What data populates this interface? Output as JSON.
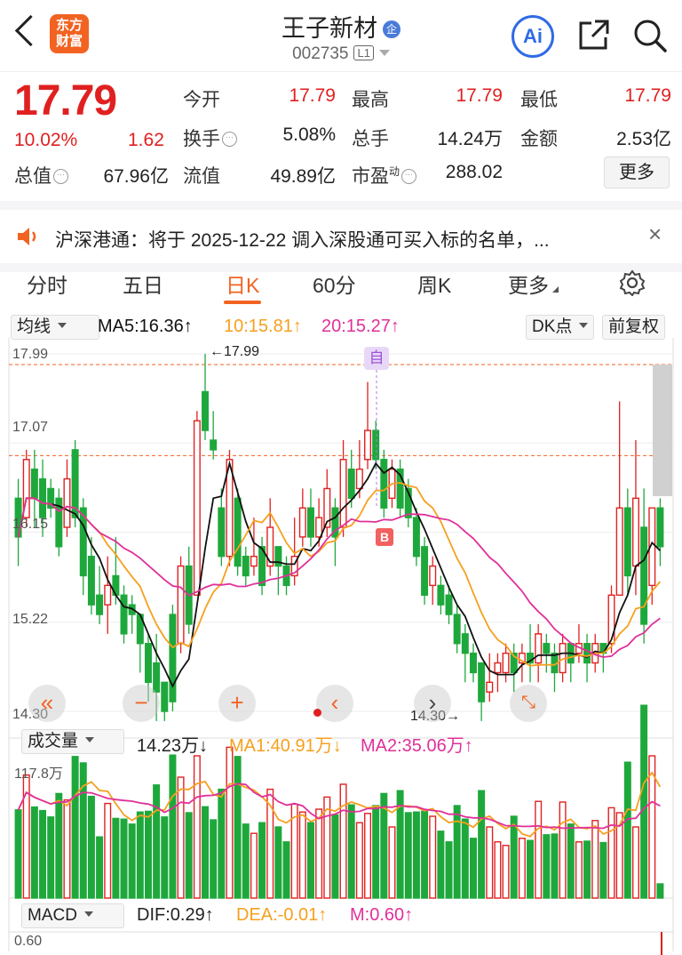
{
  "header": {
    "logo_line1": "东方",
    "logo_line2": "财富",
    "stock_name": "王子新材",
    "name_badge": "企",
    "stock_code": "002735",
    "board_badge": "L1",
    "ai_label": "Ai"
  },
  "quote": {
    "price": "17.79",
    "change_pct": "10.02%",
    "change": "1.62",
    "stats": [
      {
        "label": "今开",
        "value": "17.79",
        "red": true
      },
      {
        "label": "最高",
        "value": "17.79",
        "red": true
      },
      {
        "label": "最低",
        "value": "17.79",
        "red": true
      },
      {
        "label": "换手",
        "value": "5.08%",
        "red": false
      },
      {
        "label": "总手",
        "value": "14.24万",
        "red": false
      },
      {
        "label": "金额",
        "value": "2.53亿",
        "red": false
      },
      {
        "label": "总值",
        "value": "67.96亿",
        "red": false
      },
      {
        "label": "流值",
        "value": "49.89亿",
        "red": false
      },
      {
        "label": "市盈",
        "value": "288.02",
        "red": false
      }
    ],
    "pe_superscript": "动",
    "more_label": "更多"
  },
  "notice": {
    "text": "沪深港通：将于 2025-12-22 调入深股通可买入标的名单，..."
  },
  "tabs": [
    {
      "label": "分时",
      "active": false
    },
    {
      "label": "五日",
      "active": false
    },
    {
      "label": "日K",
      "active": true
    },
    {
      "label": "60分",
      "active": false
    },
    {
      "label": "周K",
      "active": false
    },
    {
      "label": "更多",
      "active": false
    }
  ],
  "kline": {
    "indicator_select": "均线",
    "ma5": "MA5:16.36↑",
    "ma10": "10:15.81↑",
    "ma20": "20:15.27↑",
    "dk_label": "DK点",
    "adjust_label": "前复权",
    "y_ticks": [
      "17.99",
      "17.07",
      "16.15",
      "15.22",
      "14.30"
    ],
    "high_marker": "←17.99",
    "low_marker": "14.30→",
    "self_marker": "自",
    "buy_marker": "B",
    "colors": {
      "up": "#e02020",
      "down": "#1ea83c",
      "ma5": "#111111",
      "ma10": "#f5a01f",
      "ma20": "#e0309a"
    }
  },
  "volume": {
    "select": "成交量",
    "value": "14.23万↓",
    "ma1": "MA1:40.91万↓",
    "ma2": "MA2:35.06万↑",
    "y_max": "117.8万"
  },
  "macd": {
    "select": "MACD",
    "dif": "DIF:0.29↑",
    "dea": "DEA:-0.01↑",
    "m": "M:0.60↑",
    "y_tick": "0.60"
  },
  "chart_data": {
    "type": "candlestick",
    "y_range": [
      14.3,
      17.99
    ],
    "candles": [
      [
        16.5,
        16.1,
        16.7,
        15.8
      ],
      [
        16.3,
        16.9,
        17.0,
        16.2
      ],
      [
        16.8,
        16.5,
        17.0,
        16.2
      ],
      [
        16.7,
        16.3,
        16.9,
        16.1
      ],
      [
        16.6,
        16.4,
        16.7,
        16.3
      ],
      [
        16.5,
        16.0,
        16.6,
        15.9
      ],
      [
        16.2,
        16.7,
        16.9,
        16.1
      ],
      [
        17.0,
        16.3,
        17.1,
        16.2
      ],
      [
        16.4,
        15.7,
        16.5,
        15.5
      ],
      [
        15.9,
        15.4,
        16.1,
        15.3
      ],
      [
        15.5,
        15.3,
        15.8,
        15.2
      ],
      [
        15.4,
        15.6,
        15.9,
        15.1
      ],
      [
        15.7,
        15.5,
        16.1,
        15.4
      ],
      [
        15.5,
        15.1,
        15.6,
        15.0
      ],
      [
        15.4,
        15.3,
        15.5,
        15.1
      ],
      [
        15.3,
        15.0,
        15.3,
        14.7
      ],
      [
        15.0,
        14.6,
        15.1,
        14.4
      ],
      [
        14.8,
        14.5,
        15.1,
        14.2
      ],
      [
        14.6,
        14.3,
        14.6,
        14.2
      ],
      [
        15.3,
        14.4,
        15.4,
        14.3
      ],
      [
        15.0,
        15.8,
        15.9,
        14.9
      ],
      [
        15.8,
        15.2,
        16.0,
        15.1
      ],
      [
        15.5,
        17.3,
        17.4,
        15.5
      ],
      [
        17.6,
        17.2,
        17.99,
        17.1
      ],
      [
        17.1,
        17.0,
        17.4,
        16.9
      ],
      [
        16.4,
        15.9,
        16.6,
        15.8
      ],
      [
        15.9,
        16.9,
        17.0,
        15.8
      ],
      [
        16.5,
        15.8,
        16.6,
        15.7
      ],
      [
        15.9,
        15.7,
        16.0,
        15.6
      ],
      [
        15.8,
        15.9,
        16.3,
        15.7
      ],
      [
        16.0,
        15.6,
        16.1,
        15.5
      ],
      [
        15.8,
        16.2,
        16.5,
        15.7
      ],
      [
        16.0,
        15.8,
        16.0,
        15.5
      ],
      [
        15.8,
        15.6,
        15.9,
        15.5
      ],
      [
        15.7,
        15.9,
        16.3,
        15.6
      ],
      [
        16.1,
        16.4,
        16.6,
        16.0
      ],
      [
        16.4,
        16.1,
        16.6,
        16.0
      ],
      [
        16.1,
        16.3,
        16.5,
        16.0
      ],
      [
        16.2,
        16.6,
        16.8,
        16.1
      ],
      [
        16.4,
        16.1,
        16.5,
        15.8
      ],
      [
        16.2,
        16.9,
        17.1,
        16.1
      ],
      [
        16.8,
        16.5,
        17.0,
        16.4
      ],
      [
        16.6,
        16.8,
        17.1,
        16.5
      ],
      [
        16.9,
        17.2,
        17.7,
        16.8
      ],
      [
        17.2,
        16.9,
        17.3,
        16.8
      ],
      [
        16.9,
        16.4,
        17.0,
        16.3
      ],
      [
        16.5,
        16.8,
        16.9,
        16.4
      ],
      [
        16.8,
        16.4,
        16.9,
        16.3
      ],
      [
        16.6,
        16.3,
        16.7,
        16.2
      ],
      [
        16.3,
        15.9,
        16.4,
        15.8
      ],
      [
        16.0,
        15.5,
        16.1,
        15.4
      ],
      [
        15.6,
        15.8,
        15.9,
        15.4
      ],
      [
        15.6,
        15.4,
        15.7,
        15.3
      ],
      [
        15.5,
        15.3,
        15.6,
        15.2
      ],
      [
        15.3,
        15.0,
        15.4,
        14.9
      ],
      [
        15.1,
        14.9,
        15.2,
        14.6
      ],
      [
        14.9,
        14.7,
        15.0,
        14.6
      ],
      [
        14.8,
        14.4,
        14.8,
        14.2
      ],
      [
        14.5,
        14.6,
        14.9,
        14.4
      ],
      [
        14.7,
        14.8,
        14.9,
        14.5
      ],
      [
        14.7,
        14.9,
        15.0,
        14.6
      ],
      [
        14.9,
        14.7,
        15.0,
        14.5
      ],
      [
        14.8,
        14.9,
        15.0,
        14.6
      ],
      [
        14.9,
        14.8,
        15.2,
        14.6
      ],
      [
        14.8,
        15.1,
        15.2,
        14.6
      ],
      [
        15.0,
        14.9,
        15.1,
        14.7
      ],
      [
        14.9,
        14.7,
        15.0,
        14.5
      ],
      [
        14.7,
        15.0,
        15.1,
        14.6
      ],
      [
        15.0,
        14.8,
        15.0,
        14.6
      ],
      [
        14.9,
        15.0,
        15.2,
        14.8
      ],
      [
        15.0,
        14.8,
        15.1,
        14.6
      ],
      [
        14.8,
        15.0,
        15.1,
        14.7
      ],
      [
        15.0,
        14.9,
        15.0,
        14.7
      ],
      [
        15.0,
        15.5,
        15.6,
        14.9
      ],
      [
        15.5,
        16.4,
        17.5,
        15.5
      ],
      [
        16.4,
        15.7,
        16.6,
        15.5
      ],
      [
        15.8,
        16.5,
        17.1,
        15.5
      ],
      [
        16.2,
        15.2,
        16.6,
        15.0
      ],
      [
        15.6,
        16.4,
        16.4,
        15.4
      ],
      [
        16.4,
        16.0,
        16.5,
        15.8
      ]
    ]
  }
}
